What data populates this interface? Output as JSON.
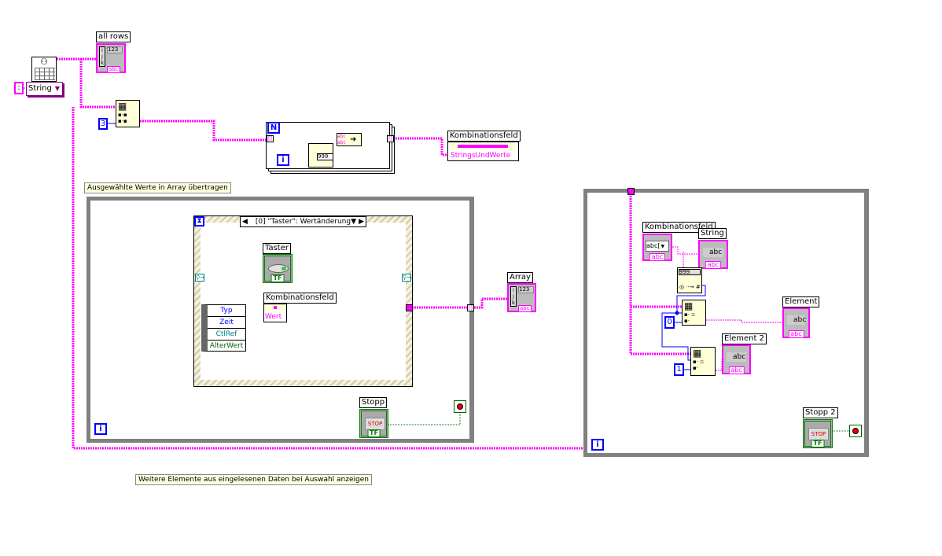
{
  "top": {
    "all_rows_label": "all rows",
    "delimiter_constant": ":",
    "format_type": "String",
    "index_constant": "3",
    "idx_123": "123",
    "abc_tag": "abc"
  },
  "for_loop": {
    "count_terminal": "N",
    "iteration_terminal": "i",
    "number_format": "999"
  },
  "combo_top": {
    "label": "Kombinationsfeld",
    "property": "StringsUndWerte"
  },
  "comments": {
    "first": "Ausgewählte Werte in Array übertragen",
    "second": "Weitere Elemente aus eingelesenen Daten bei Auswahl anzeigen"
  },
  "loop1": {
    "iteration_terminal": "i",
    "event_selector": "[0] \"Taster\": Wertänderung",
    "taster_label": "Taster",
    "bool_tag": "TF",
    "event_data": [
      "Typ",
      "Zeit",
      "CtlRef",
      "AlterWert"
    ],
    "combo_label": "Kombinationsfeld",
    "combo_property": "Wert",
    "array_label": "Array",
    "stop_label": "Stopp",
    "stop_text": "STOP"
  },
  "loop2": {
    "iteration_terminal": "i",
    "combo_label": "Kombinationsfeld",
    "combo_value": "abc[",
    "string_label": "String",
    "number_format": "999",
    "index0": "0",
    "index1": "1",
    "element_label": "Element",
    "element2_label": "Element 2",
    "abc": "abc",
    "stop_label": "Stopp 2",
    "stop_text": "STOP"
  },
  "colors": {
    "string_wire": "#ff00ff",
    "numeric_wire": "#0000ff",
    "boolean_wire": "#006400",
    "loop_border": "#808080"
  }
}
